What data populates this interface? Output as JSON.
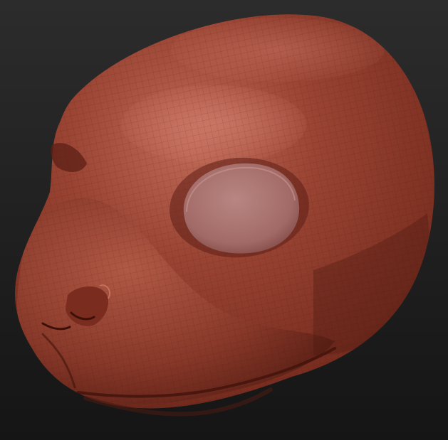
{
  "scene": {
    "subject": "sculpted-animal-head",
    "colors": {
      "background_top": "#2c2c2c",
      "background_bottom": "#151515",
      "clay_base": "#8a3a2a",
      "clay_highlight": "#c06a58",
      "clay_shadow": "#4a1a12",
      "eye_socket": "#a26a66",
      "eye_socket_rim": "#5c1f16",
      "wireframe": "#3a1008"
    }
  }
}
